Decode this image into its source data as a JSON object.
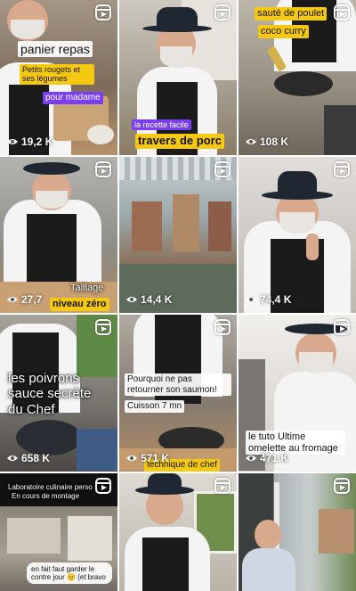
{
  "colors": {
    "caption_yellow": "#f5c912",
    "caption_purple": "#7b3ff2",
    "caption_white": "#ffffff"
  },
  "icons": {
    "reel": "reels-icon",
    "views": "eye-icon"
  },
  "tiles": [
    {
      "captions": [
        "panier repas",
        "Petits rougets et ses légumes",
        "pour madame"
      ],
      "views": "19,2 K"
    },
    {
      "captions": [
        "la recette facile",
        "travers de porc"
      ],
      "views": ""
    },
    {
      "captions": [
        "sauté de poulet",
        "coco curry"
      ],
      "views": "108 K"
    },
    {
      "captions": [
        "Taillage",
        "niveau zéro"
      ],
      "views": "27,7"
    },
    {
      "captions": [],
      "views": "14,4 K"
    },
    {
      "captions": [],
      "views": "74,4 K"
    },
    {
      "captions": [
        "les poivrons sauce secrète du Chef"
      ],
      "views": "658 K"
    },
    {
      "captions": [
        "Pourquoi ne pas retourner son saumon!",
        "Cuisson 7 mn",
        "technique de chef"
      ],
      "views": "571 K"
    },
    {
      "captions": [
        "le tuto Ultime omelette au fromage"
      ],
      "views": "471 K"
    },
    {
      "captions": [
        "Laboratoire culinaire perso",
        "En cours de montage",
        "en fait faut garder le contre jour 😊 (et bravo"
      ],
      "views": ""
    },
    {
      "captions": [],
      "views": ""
    },
    {
      "captions": [],
      "views": ""
    }
  ]
}
